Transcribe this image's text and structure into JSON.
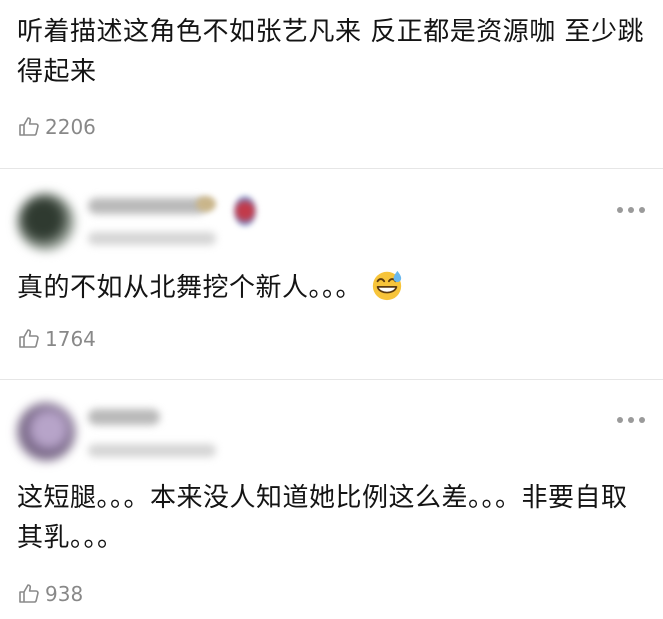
{
  "comments": [
    {
      "text": "听着描述这角色不如张艺凡来 反正都是资源咖 至少跳得起来",
      "likes": "2206"
    },
    {
      "text": "真的不如从北舞挖个新人。。。",
      "emoji": "grinning-sweat-emoji",
      "likes": "1764"
    },
    {
      "text": "这短腿。。。本来没人知道她比例这么差。。。非要自取其乳。。。",
      "likes": "938"
    }
  ],
  "icons": {
    "like": "thumbs-up-icon",
    "more": "more-dots-icon"
  },
  "colors": {
    "text": "#141414",
    "meta": "#888888",
    "divider": "#e6e6e6"
  }
}
